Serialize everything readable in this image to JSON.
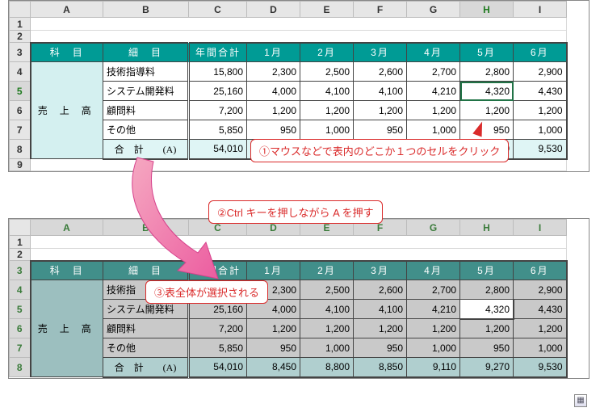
{
  "columns": [
    "A",
    "B",
    "C",
    "D",
    "E",
    "F",
    "G",
    "H",
    "I"
  ],
  "rows_top": [
    "1",
    "2",
    "3",
    "4",
    "5",
    "6",
    "7",
    "8",
    "9"
  ],
  "rows_bottom": [
    "1",
    "2",
    "3",
    "4",
    "5",
    "6",
    "7",
    "8"
  ],
  "headers": {
    "kamoku": "科　目",
    "saimoku": "細　目",
    "nenkan": "年間合計",
    "m1": "1月",
    "m2": "2月",
    "m3": "3月",
    "m4": "4月",
    "m5": "5月",
    "m6": "6月"
  },
  "row_group_label": "売 上 高",
  "items": [
    {
      "name": "技術指導料",
      "vals": [
        "15,800",
        "2,300",
        "2,500",
        "2,600",
        "2,700",
        "2,800",
        "2,900"
      ]
    },
    {
      "name": "システム開発料",
      "vals": [
        "25,160",
        "4,000",
        "4,100",
        "4,100",
        "4,210",
        "4,320",
        "4,430"
      ]
    },
    {
      "name": "顧問料",
      "vals": [
        "7,200",
        "1,200",
        "1,200",
        "1,200",
        "1,200",
        "1,200",
        "1,200"
      ]
    },
    {
      "name": "その他",
      "vals": [
        "5,850",
        "950",
        "1,000",
        "950",
        "1,000",
        "950",
        "1,000"
      ]
    }
  ],
  "total": {
    "label": "合　計　　(A)",
    "vals": [
      "54,010",
      "8,450",
      "8,800",
      "8,850",
      "9,110",
      "9,270",
      "9,530"
    ]
  },
  "bottom_item0_short": "技術指",
  "callouts": {
    "c1": "①マウスなどで表内のどこか１つのセルをクリック",
    "c2": "②Ctrl キーを押しながら A を押す",
    "c3": "③表全体が選択される"
  },
  "chart_data": {
    "type": "table",
    "title": "売上高",
    "columns": [
      "細目",
      "年間合計",
      "1月",
      "2月",
      "3月",
      "4月",
      "5月",
      "6月"
    ],
    "rows": [
      [
        "技術指導料",
        15800,
        2300,
        2500,
        2600,
        2700,
        2800,
        2900
      ],
      [
        "システム開発料",
        25160,
        4000,
        4100,
        4100,
        4210,
        4320,
        4430
      ],
      [
        "顧問料",
        7200,
        1200,
        1200,
        1200,
        1200,
        1200,
        1200
      ],
      [
        "その他",
        5850,
        950,
        1000,
        950,
        1000,
        950,
        1000
      ],
      [
        "合計 (A)",
        54010,
        8450,
        8800,
        8850,
        9110,
        9270,
        9530
      ]
    ]
  }
}
